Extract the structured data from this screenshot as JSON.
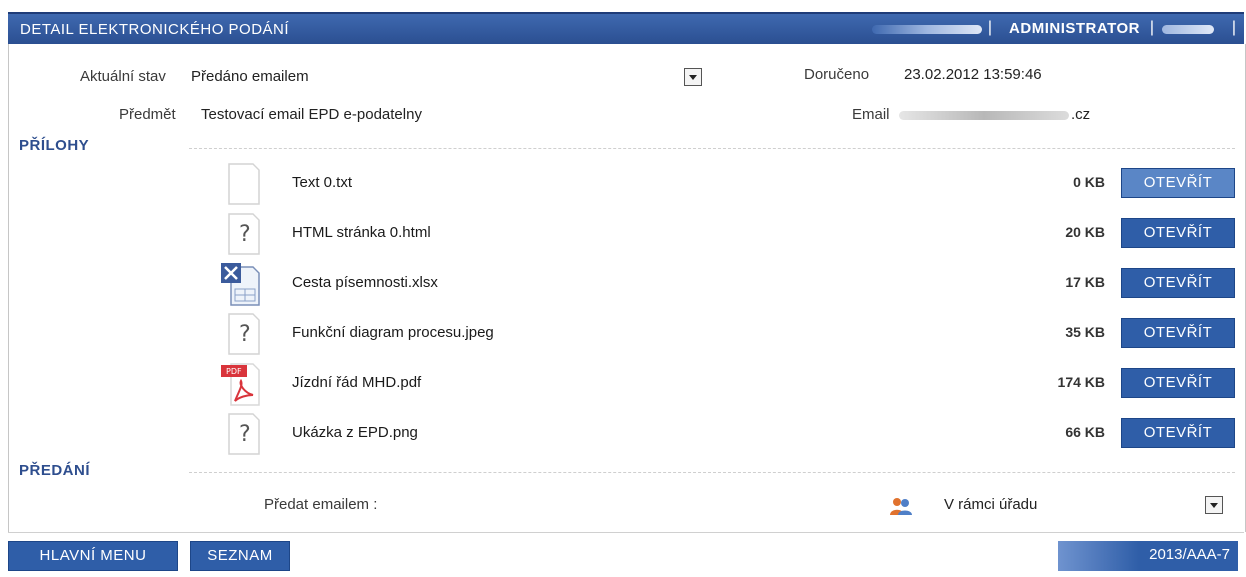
{
  "header": {
    "title": "DETAIL ELEKTRONICKÉHO PODÁNÍ",
    "user_role": "ADMINISTRATOR",
    "separator": "|"
  },
  "info": {
    "state_label": "Aktuální stav",
    "state_value": "Předáno emailem",
    "subject_label": "Předmět",
    "subject_value": "Testovací email EPD e-podatelny",
    "delivered_label": "Doručeno",
    "delivered_value": "23.02.2012 13:59:46",
    "email_label": "Email",
    "email_suffix": ".cz"
  },
  "attachments": {
    "section_title": "PŘÍLOHY",
    "button_label": "OTEVŘÍT",
    "items": [
      {
        "name": "Text 0.txt",
        "size": "0 KB",
        "icon": "text-file-icon"
      },
      {
        "name": "HTML stránka 0.html",
        "size": "20 KB",
        "icon": "unknown-file-icon"
      },
      {
        "name": "Cesta písemnosti.xlsx",
        "size": "17 KB",
        "icon": "excel-file-icon"
      },
      {
        "name": "Funkční diagram procesu.jpeg",
        "size": "35 KB",
        "icon": "unknown-file-icon"
      },
      {
        "name": "Jízdní řád MHD.pdf",
        "size": "174 KB",
        "icon": "pdf-file-icon"
      },
      {
        "name": "Ukázka z EPD.png",
        "size": "66 KB",
        "icon": "unknown-file-icon"
      }
    ]
  },
  "handover": {
    "section_title": "PŘEDÁNÍ",
    "forward_label": "Předat emailem :",
    "scope_value": "V rámci úřadu"
  },
  "footer": {
    "main_menu": "HLAVNÍ MENU",
    "list": "SEZNAM",
    "document_number": "2013/AAA-7"
  },
  "colors": {
    "header_bg": "#2b4f91",
    "button_bg": "#2f5ea8",
    "section_text": "#2e4e8e"
  }
}
